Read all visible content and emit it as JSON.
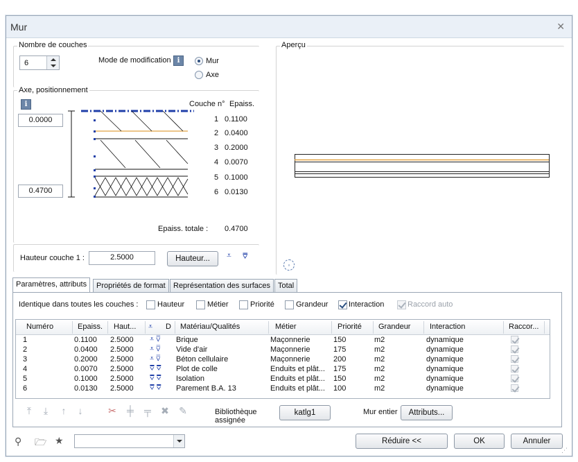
{
  "window": {
    "title": "Mur"
  },
  "layers_group": {
    "label": "Nombre de couches",
    "count": "6"
  },
  "mode": {
    "label": "Mode de modification",
    "options": [
      "Mur",
      "Axe"
    ],
    "selected": "Mur"
  },
  "axis_group": {
    "label": "Axe, positionnement",
    "top_value": "0.0000",
    "bottom_value": "0.4700",
    "col_layer": "Couche n°",
    "col_thickness": "Epaiss.",
    "layers": [
      {
        "n": "1",
        "t": "0.1100"
      },
      {
        "n": "2",
        "t": "0.0400"
      },
      {
        "n": "3",
        "t": "0.2000"
      },
      {
        "n": "4",
        "t": "0.0070"
      },
      {
        "n": "5",
        "t": "0.1000"
      },
      {
        "n": "6",
        "t": "0.0130"
      }
    ],
    "total_label": "Epaiss. totale :",
    "total_value": "0.4700"
  },
  "height": {
    "label": "Hauteur couche 1 :",
    "value": "2.5000",
    "button": "Hauteur..."
  },
  "preview": {
    "label": "Aperçu"
  },
  "tabs": [
    "Paramètres, attributs",
    "Propriétés de format",
    "Représentation des surfaces",
    "Total"
  ],
  "identical": {
    "label": "Identique dans toutes les couches :",
    "items": [
      {
        "label": "Hauteur",
        "checked": false,
        "disabled": false
      },
      {
        "label": "Métier",
        "checked": false,
        "disabled": false
      },
      {
        "label": "Priorité",
        "checked": false,
        "disabled": false
      },
      {
        "label": "Grandeur",
        "checked": false,
        "disabled": false
      },
      {
        "label": "Interaction",
        "checked": true,
        "disabled": false
      },
      {
        "label": "Raccord auto",
        "checked": true,
        "disabled": true
      }
    ]
  },
  "table": {
    "headers": [
      "Numéro",
      "Epaiss.",
      "Haut...",
      "D",
      "Matériau/Qualités",
      "Métier",
      "Priorité",
      "Grandeur",
      "Interaction",
      "Raccor..."
    ],
    "rows": [
      {
        "num": "1",
        "ep": "0.1100",
        "h": "2.5000",
        "mat": "Brique",
        "metier": "Maçonnerie",
        "prio": "150",
        "gr": "m2",
        "inter": "dynamique"
      },
      {
        "num": "2",
        "ep": "0.0400",
        "h": "2.5000",
        "mat": "Vide d'air",
        "metier": "Maçonnerie",
        "prio": "175",
        "gr": "m2",
        "inter": "dynamique"
      },
      {
        "num": "3",
        "ep": "0.2000",
        "h": "2.5000",
        "mat": "Béton cellulaire",
        "metier": "Maçonnerie",
        "prio": "200",
        "gr": "m2",
        "inter": "dynamique"
      },
      {
        "num": "4",
        "ep": "0.0070",
        "h": "2.5000",
        "mat": "Plot de colle",
        "metier": "Enduits et plât...",
        "prio": "175",
        "gr": "m2",
        "inter": "dynamique"
      },
      {
        "num": "5",
        "ep": "0.1000",
        "h": "2.5000",
        "mat": "Isolation",
        "metier": "Enduits et plât...",
        "prio": "150",
        "gr": "m2",
        "inter": "dynamique"
      },
      {
        "num": "6",
        "ep": "0.0130",
        "h": "2.5000",
        "mat": "Parement B.A. 13",
        "metier": "Enduits et plât...",
        "prio": "100",
        "gr": "m2",
        "inter": "dynamique"
      }
    ]
  },
  "library": {
    "label": "Bibliothèque assignée",
    "button": "katlg1"
  },
  "whole_wall": {
    "label": "Mur entier",
    "button": "Attributs..."
  },
  "footer": {
    "combo_value": "",
    "reduce": "Réduire <<",
    "ok": "OK",
    "cancel": "Annuler"
  },
  "colors": {
    "accent": "#1f3fa8",
    "orange_line": "#e0a040",
    "frame": "#9aa8b8"
  }
}
